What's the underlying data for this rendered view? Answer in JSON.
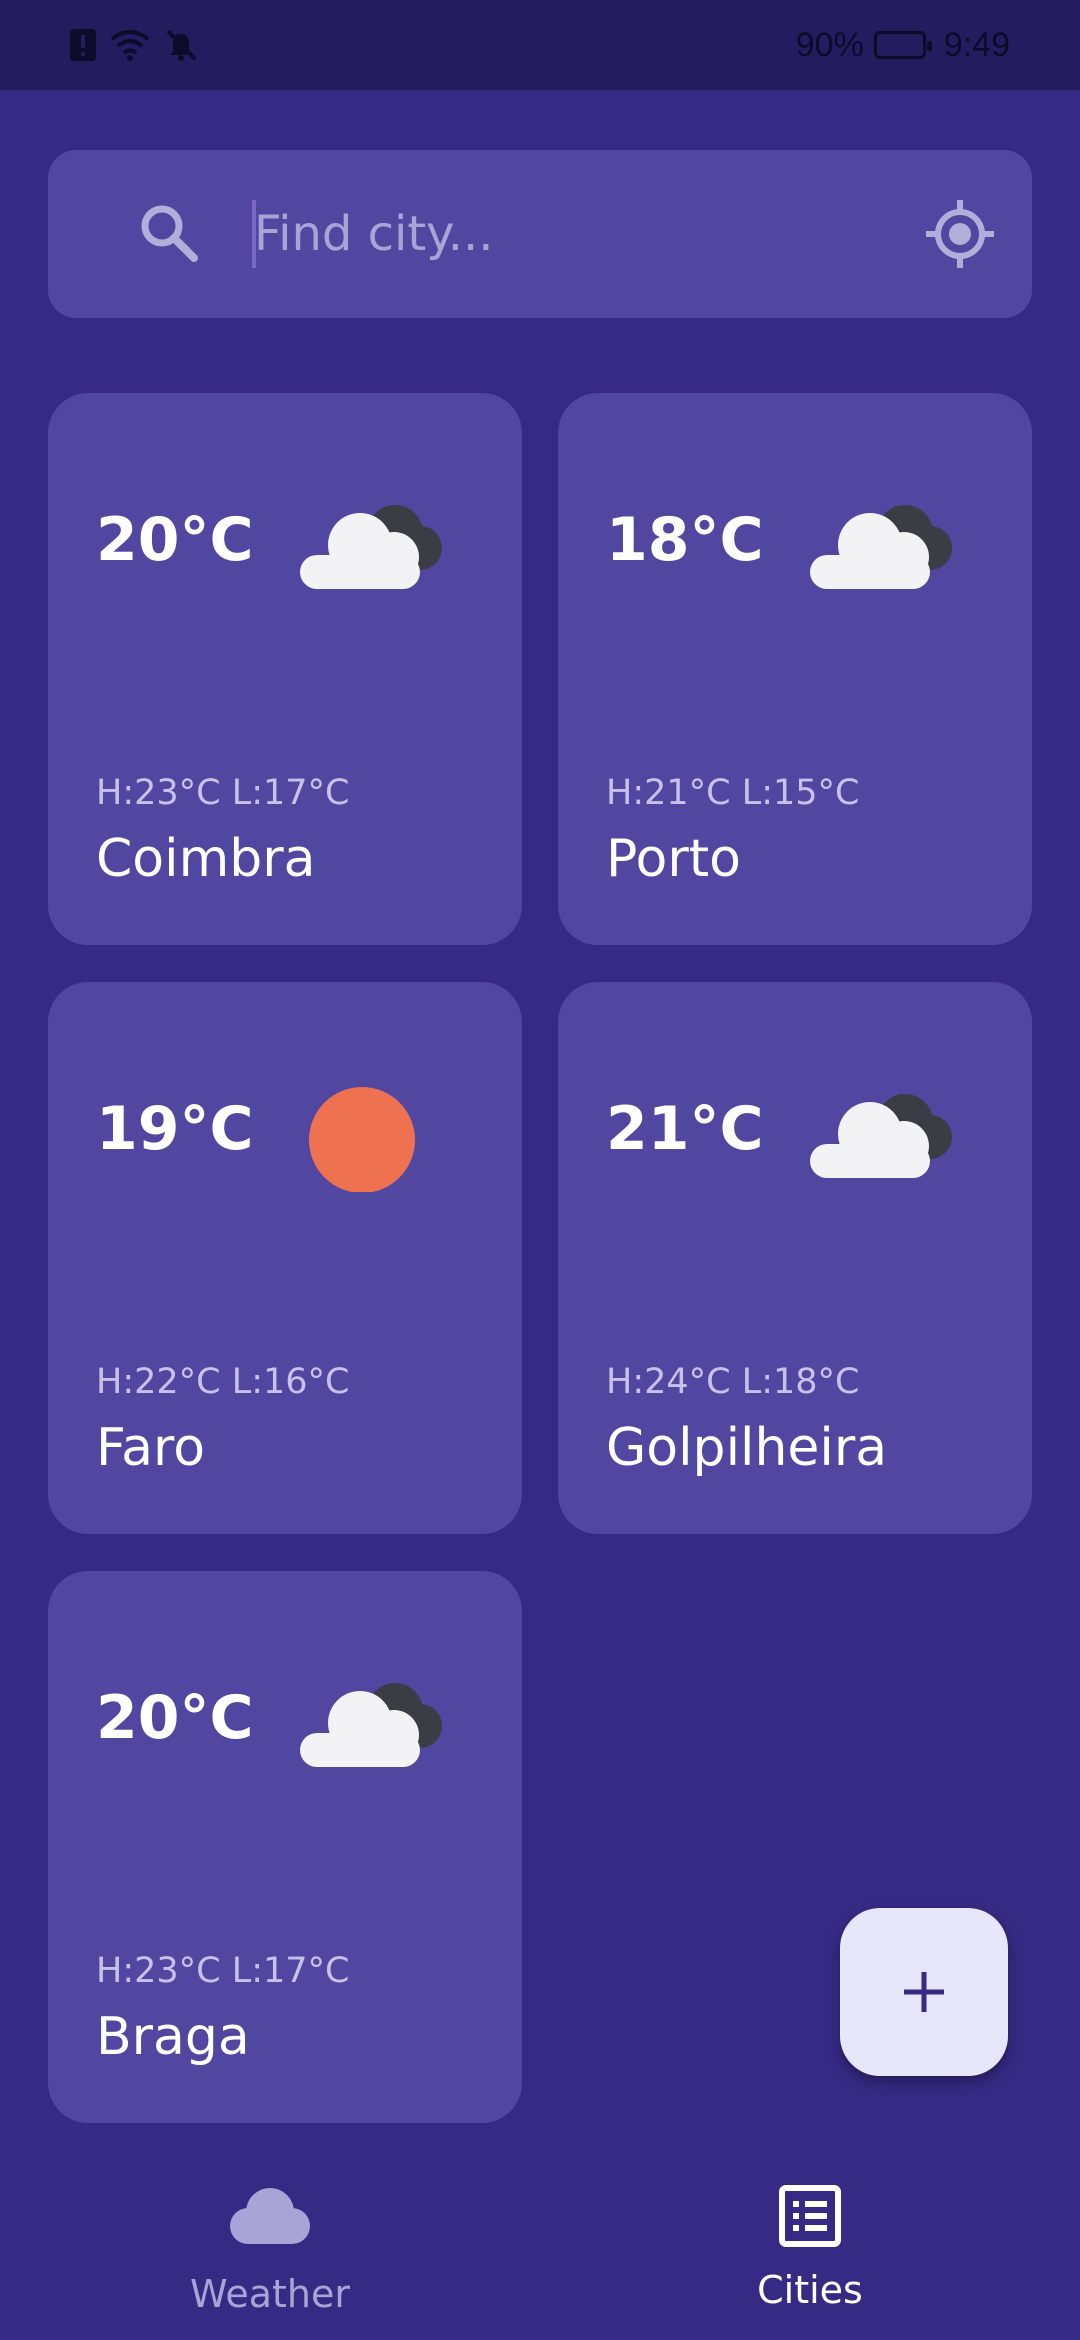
{
  "status_bar": {
    "battery_percent": "90%",
    "time": "9:49",
    "icons": [
      "alert-icon",
      "wifi-icon",
      "bell-off-icon",
      "battery-charging-icon"
    ]
  },
  "search": {
    "placeholder": "Find city...",
    "value": "",
    "icons": [
      "search-icon",
      "my-location-icon"
    ]
  },
  "cities": [
    {
      "temp": "20°C",
      "high_low": "H:23°C  L:17°C",
      "name": "Coimbra",
      "condition": "cloudy"
    },
    {
      "temp": "18°C",
      "high_low": "H:21°C  L:15°C",
      "name": "Porto",
      "condition": "cloudy"
    },
    {
      "temp": "19°C",
      "high_low": "H:22°C  L:16°C",
      "name": "Faro",
      "condition": "sunny"
    },
    {
      "temp": "21°C",
      "high_low": "H:24°C  L:18°C",
      "name": "Golpilheira",
      "condition": "cloudy"
    },
    {
      "temp": "20°C",
      "high_low": "H:23°C  L:17°C",
      "name": "Braga",
      "condition": "cloudy"
    }
  ],
  "fab": {
    "icon": "plus-icon"
  },
  "bottom_nav": {
    "items": [
      {
        "label": "Weather",
        "icon": "cloud-icon",
        "active": false
      },
      {
        "label": "Cities",
        "icon": "list-icon",
        "active": true
      }
    ]
  },
  "colors": {
    "background": "#372a85",
    "status_bar": "#241c5e",
    "card": "#5147a0",
    "sun": "#ee7150",
    "fab": "#e6e7fb",
    "inactive_nav": "#a9a3d6"
  }
}
